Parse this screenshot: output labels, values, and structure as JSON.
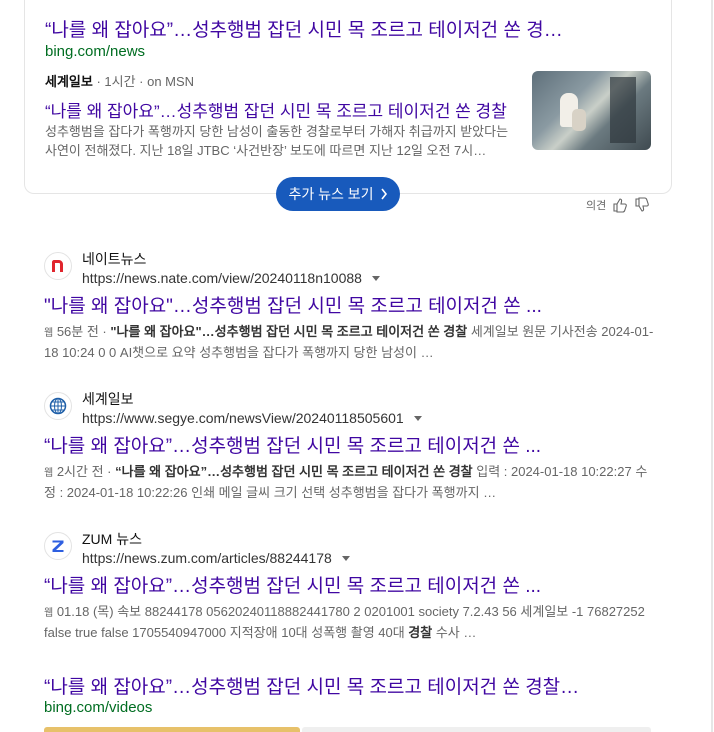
{
  "top_card": {
    "title": "“나를 왜 잡아요”…성추행범 잡던 시민 목 조르고 테이저건 쏜 경찰…",
    "domain": "bing.com/news",
    "publisher": "세계일보",
    "meta": "· 1시간 · on MSN",
    "article_title": "“나를 왜 잡아요”…성추행범 잡던 시민 목 조르고 테이저건 쏜 경찰",
    "snippet": "성추행범을 잡다가 폭행까지 당한 남성이 출동한 경찰로부터 가해자 취급까지 받았다는 사연이 전해졌다. 지난 18일 JTBC ‘사건반장’ 보도에 따르면 지난 12일 오전 7시…",
    "more_button": "추가 뉴스 보기",
    "feedback_label": "의견"
  },
  "results": [
    {
      "site_name": "네이트뉴스",
      "url": "https://news.nate.com/view/20240118n10088",
      "title": "\"나를 왜 잡아요\"…성추행범 잡던 시민 목 조르고 테이저건 쏜 ...",
      "badge": "웹",
      "snip_a": "56분 전 · ",
      "snip_b": "\"나를 왜 잡아요\"…성추행범 잡던 시민 목 조르고 테이저건 쏜 경찰",
      "snip_c": " 세계일보 원문 기사전송 2024-01-18 10:24 0 0 AI챗으로 요약 성추행범을 잡다가 폭행까지 당한 남성이 …"
    },
    {
      "site_name": "세계일보",
      "url": "https://www.segye.com/newsView/20240118505601",
      "title": "“나를 왜 잡아요”…성추행범 잡던 시민 목 조르고 테이저건 쏜 ...",
      "badge": "웹",
      "snip_a": "2시간 전 · ",
      "snip_b": "“나를 왜 잡아요”…성추행범 잡던 시민 목 조르고 테이저건 쏜 경찰",
      "snip_c": " 입력 : 2024-01-18 10:22:27 수정 : 2024-01-18 10:22:26 인쇄 메일 글씨 크기 선택 성추행범을 잡다가 폭행까지 …"
    },
    {
      "site_name": "ZUM 뉴스",
      "url": "https://news.zum.com/articles/88244178",
      "title": "“나를 왜 잡아요”…성추행범 잡던 시민 목 조르고 테이저건 쏜 ...",
      "badge": "웹",
      "snip_a": "01.18 (목) 속보 88244178 05620240118882441780 2 0201001 society 7.2.43 56 세계일보 -1 76827252 false true false 1705540947000 지적장애 10대 성폭행 촬영 40대 ",
      "snip_b": "경찰",
      "snip_c": " 수사 …"
    }
  ],
  "video_result": {
    "title": "“나를 왜 잡아요”…성추행범 잡던 시민 목 조르고 테이저건 쏜 경찰 …",
    "domain": "bing.com/videos"
  },
  "colors": {
    "link": "#4007a2",
    "green": "#006d21",
    "button": "#185abc"
  }
}
